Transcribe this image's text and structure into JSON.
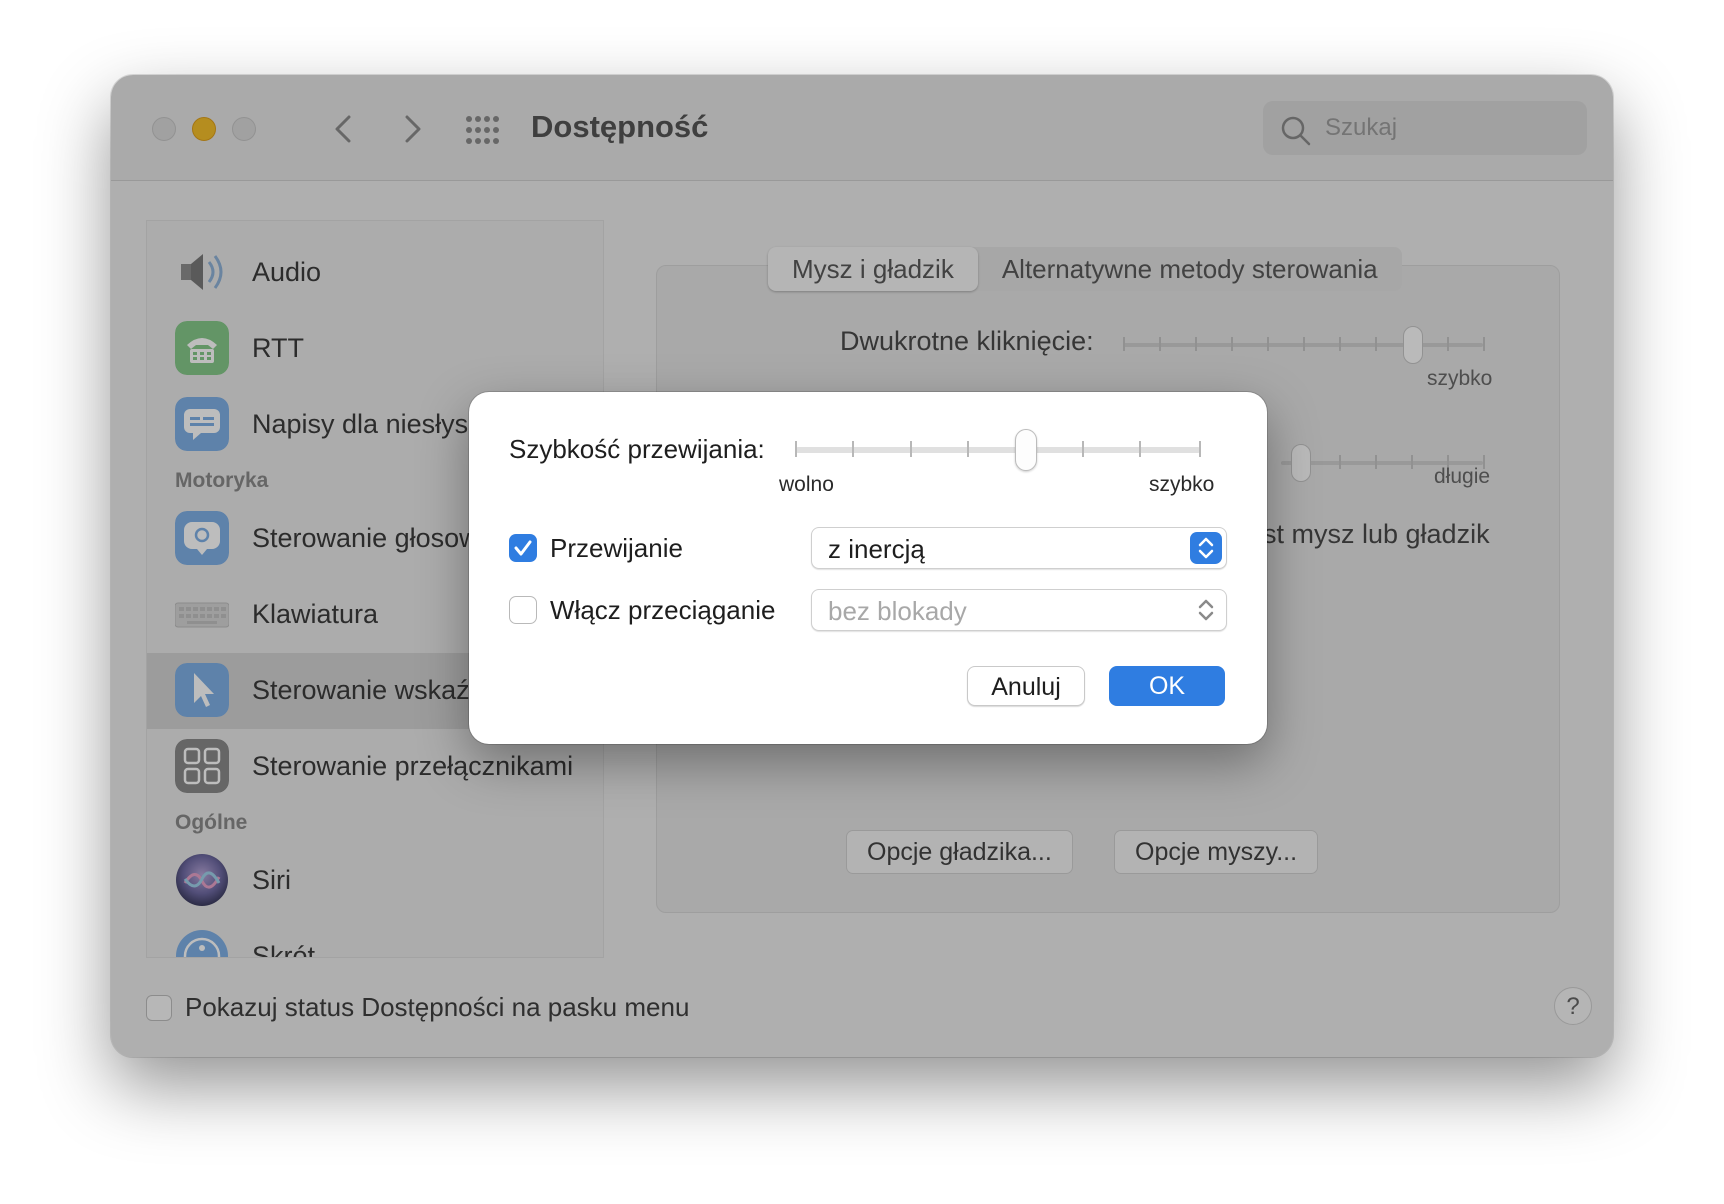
{
  "window": {
    "title": "Dostępność",
    "search_placeholder": "Szukaj"
  },
  "sidebar": {
    "items": [
      {
        "label": "Audio",
        "icon": "speaker-icon"
      },
      {
        "label": "RTT",
        "icon": "tty-phone-icon"
      },
      {
        "label": "Napisy dla niesłys",
        "icon": "captions-icon"
      },
      {
        "label": "Sterowanie głosow",
        "icon": "voice-control-icon"
      },
      {
        "label": "Klawiatura",
        "icon": "keyboard-icon"
      },
      {
        "label": "Sterowanie wskaź",
        "icon": "pointer-icon",
        "selected": true
      },
      {
        "label": "Sterowanie przełącznikami",
        "icon": "switch-control-icon"
      },
      {
        "label": "Siri",
        "icon": "siri-icon"
      },
      {
        "label": "Skrót",
        "icon": "accessibility-shortcut-icon"
      }
    ],
    "sections": {
      "motor": "Motoryka",
      "general": "Ogólne"
    }
  },
  "content": {
    "tabs": [
      "Mysz i gładzik",
      "Alternatywne metody sterowania"
    ],
    "double_click_label": "Dwukrotne kliknięcie:",
    "fast_label": "szybko",
    "long_label": "długie",
    "mouse_trackpad_text": "st mysz lub gładzik",
    "trackpad_options": "Opcje gładzika...",
    "mouse_options": "Opcje myszy..."
  },
  "footer": {
    "status_label": "Pokazuj status Dostępności na pasku menu",
    "help": "?"
  },
  "dialog": {
    "scroll_speed_label": "Szybkość przewijania:",
    "slow_label": "wolno",
    "fast_label": "szybko",
    "scroll_speed_value_fraction": 0.57,
    "scrolling": {
      "label": "Przewijanie",
      "checked": true,
      "value": "z inercją"
    },
    "dragging": {
      "label": "Włącz przeciąganie",
      "checked": false,
      "value": "bez blokady"
    },
    "cancel_label": "Anuluj",
    "ok_label": "OK"
  },
  "colors": {
    "accent": "#2f7de1",
    "traffic_yellow": "#f5bf2b"
  }
}
